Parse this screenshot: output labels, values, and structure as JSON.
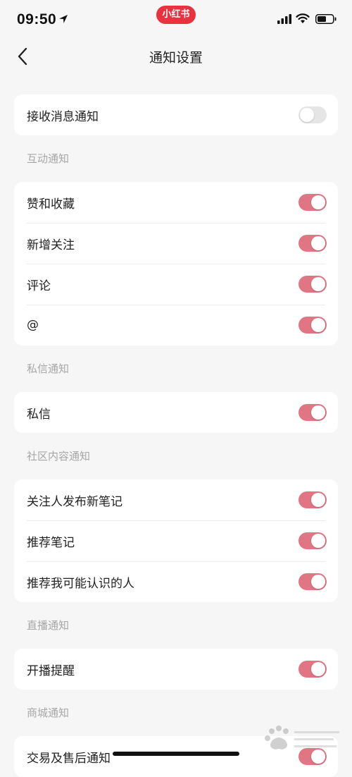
{
  "status_bar": {
    "time": "09:50",
    "app_badge": "小红书"
  },
  "nav": {
    "title": "通知设置"
  },
  "master": {
    "label": "接收消息通知",
    "on": false
  },
  "sections": [
    {
      "header": "互动通知",
      "items": [
        {
          "label": "赞和收藏",
          "on": true
        },
        {
          "label": "新增关注",
          "on": true
        },
        {
          "label": "评论",
          "on": true
        },
        {
          "label": "@",
          "on": true
        }
      ]
    },
    {
      "header": "私信通知",
      "items": [
        {
          "label": "私信",
          "on": true
        }
      ]
    },
    {
      "header": "社区内容通知",
      "items": [
        {
          "label": "关注人发布新笔记",
          "on": true
        },
        {
          "label": "推荐笔记",
          "on": true
        },
        {
          "label": "推荐我可能认识的人",
          "on": true
        }
      ]
    },
    {
      "header": "直播通知",
      "items": [
        {
          "label": "开播提醒",
          "on": true
        }
      ]
    },
    {
      "header": "商城通知",
      "items": [
        {
          "label": "交易及售后通知",
          "on": true
        }
      ]
    }
  ],
  "colors": {
    "toggle_on": "#e07584",
    "toggle_off": "#e5e5e5",
    "brand": "#e8323f"
  },
  "icons": {
    "back": "chevron-left-icon",
    "location": "location-arrow-icon",
    "signal": "cellular-signal-icon",
    "wifi": "wifi-icon",
    "battery": "battery-icon"
  }
}
